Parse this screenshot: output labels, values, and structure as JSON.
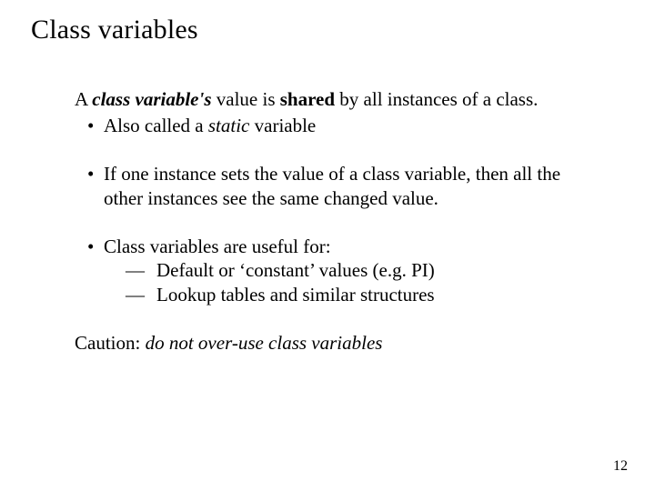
{
  "title": "Class variables",
  "lead": {
    "p1": "A ",
    "p2": "class variable's",
    "p3": " value is ",
    "p4": "shared",
    "p5": " by all instances of a class."
  },
  "bullet1": {
    "pre": "Also called a ",
    "em": "static",
    "post": " variable"
  },
  "bullet2": "If one instance sets the value of a class variable, then all the other instances see the same changed value.",
  "bullet3": "Class variables are useful for:",
  "sub1": "Default or ‘constant’ values (e.g. PI)",
  "sub2": "Lookup tables and similar structures",
  "caution": {
    "pre": "Caution: ",
    "em": "do not over-use class variables"
  },
  "dot": "•",
  "dash": "—",
  "page": "12"
}
